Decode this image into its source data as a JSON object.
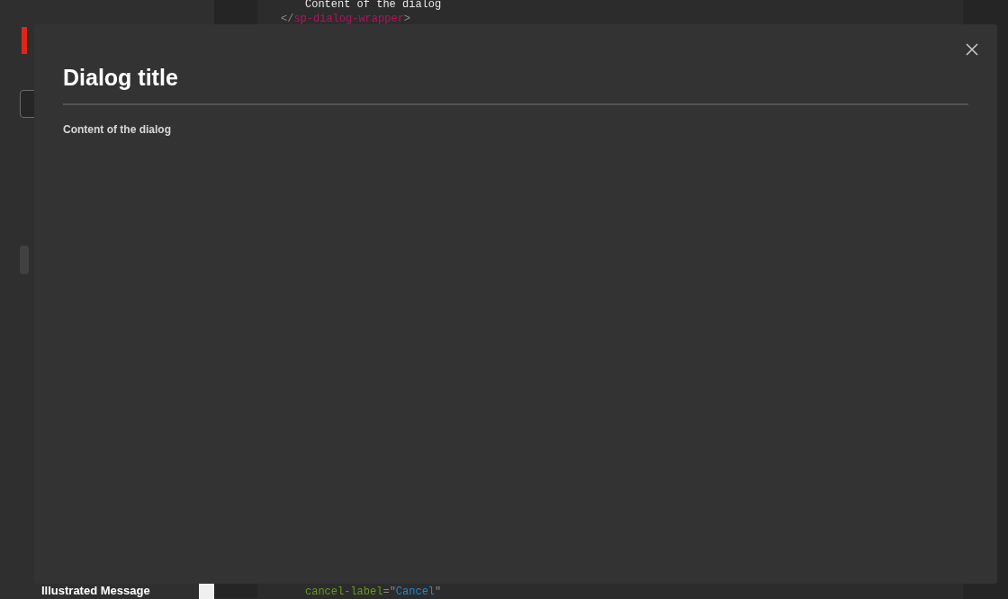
{
  "background": {
    "code_top": [
      {
        "tokens": [
          {
            "kind": "text",
            "text": "Content of the dialog"
          }
        ],
        "indent": true
      },
      {
        "tokens": [
          {
            "kind": "punct",
            "text": "</"
          },
          {
            "kind": "tag",
            "text": "sp-dialog-wrapper"
          },
          {
            "kind": "punct",
            "text": ">"
          }
        ],
        "indent": false
      }
    ],
    "sidebar_item": "Illustrated Message",
    "code_bottom": [
      {
        "tokens": [
          {
            "kind": "attr",
            "text": "cancel-label"
          },
          {
            "kind": "punct",
            "text": "="
          },
          {
            "kind": "punct",
            "text": "\""
          },
          {
            "kind": "string",
            "text": "Cancel"
          },
          {
            "kind": "punct",
            "text": "\""
          }
        ],
        "indent": true
      }
    ]
  },
  "dialog": {
    "title": "Dialog title",
    "content": "Content of the dialog"
  }
}
